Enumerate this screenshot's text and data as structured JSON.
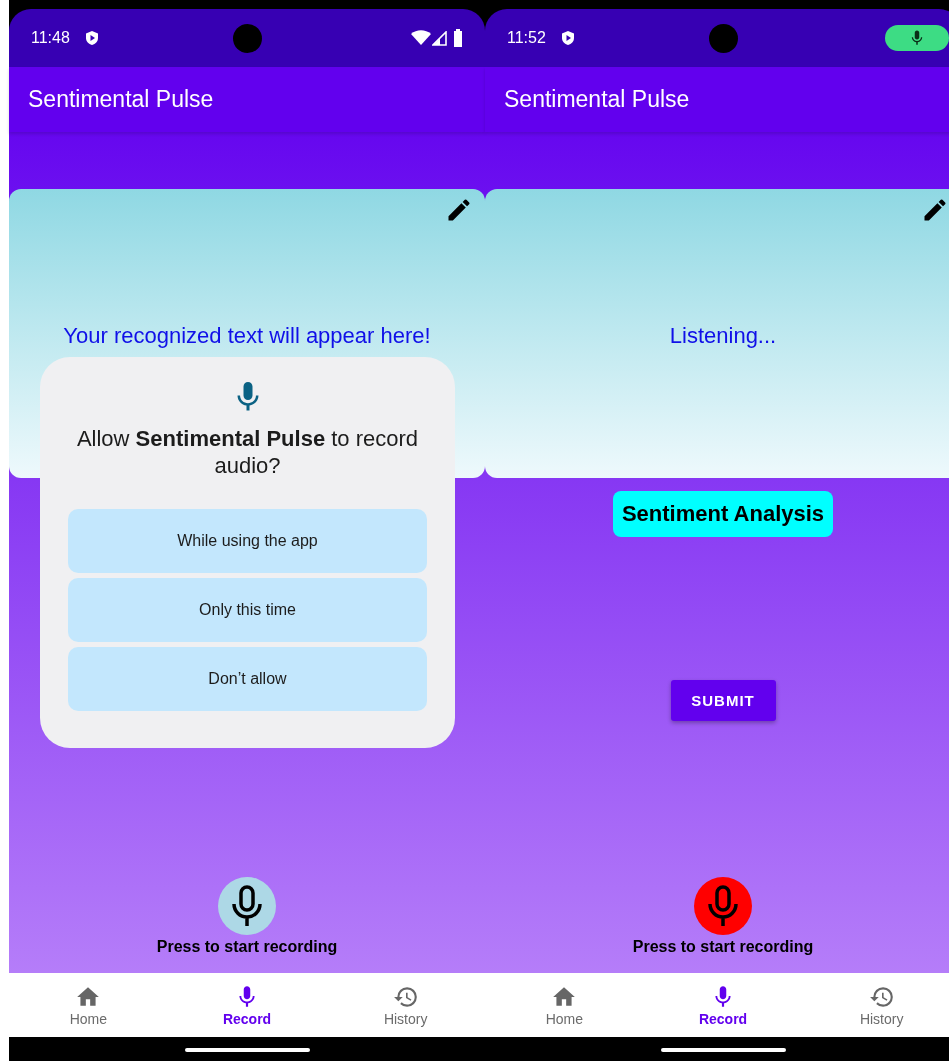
{
  "phones": [
    {
      "status_bar": {
        "time": "11:48",
        "indicator": {
          "kind": "system_icons"
        }
      },
      "app_bar": {
        "title": "Sentimental Pulse"
      },
      "card": {
        "text": "Your recognized text will appear here!"
      },
      "mic_button": {
        "label": "Press to start recording",
        "recording": false
      },
      "nav": [
        {
          "label": "Home",
          "kind": "home",
          "selected": false
        },
        {
          "label": "Record",
          "kind": "mic",
          "selected": true
        },
        {
          "label": "History",
          "kind": "history",
          "selected": false
        }
      ],
      "dialog": {
        "message": "Allow **Sentimental Pulse** to record audio?",
        "options": [
          "While using the app",
          "Only this time",
          "Don’t allow"
        ]
      }
    },
    {
      "status_bar": {
        "time": "11:52",
        "indicator": {
          "kind": "mic_indicator"
        }
      },
      "app_bar": {
        "title": "Sentimental Pulse"
      },
      "card": {
        "text": "Listening..."
      },
      "sentiment_button": {
        "label": "Sentiment Analysis"
      },
      "submit_button": {
        "label": "SUBMIT"
      },
      "mic_button": {
        "label": "Press to start recording",
        "recording": true
      },
      "nav": [
        {
          "label": "Home",
          "kind": "home",
          "selected": false
        },
        {
          "label": "Record",
          "kind": "mic",
          "selected": true
        },
        {
          "label": "History",
          "kind": "history",
          "selected": false
        }
      ]
    }
  ]
}
